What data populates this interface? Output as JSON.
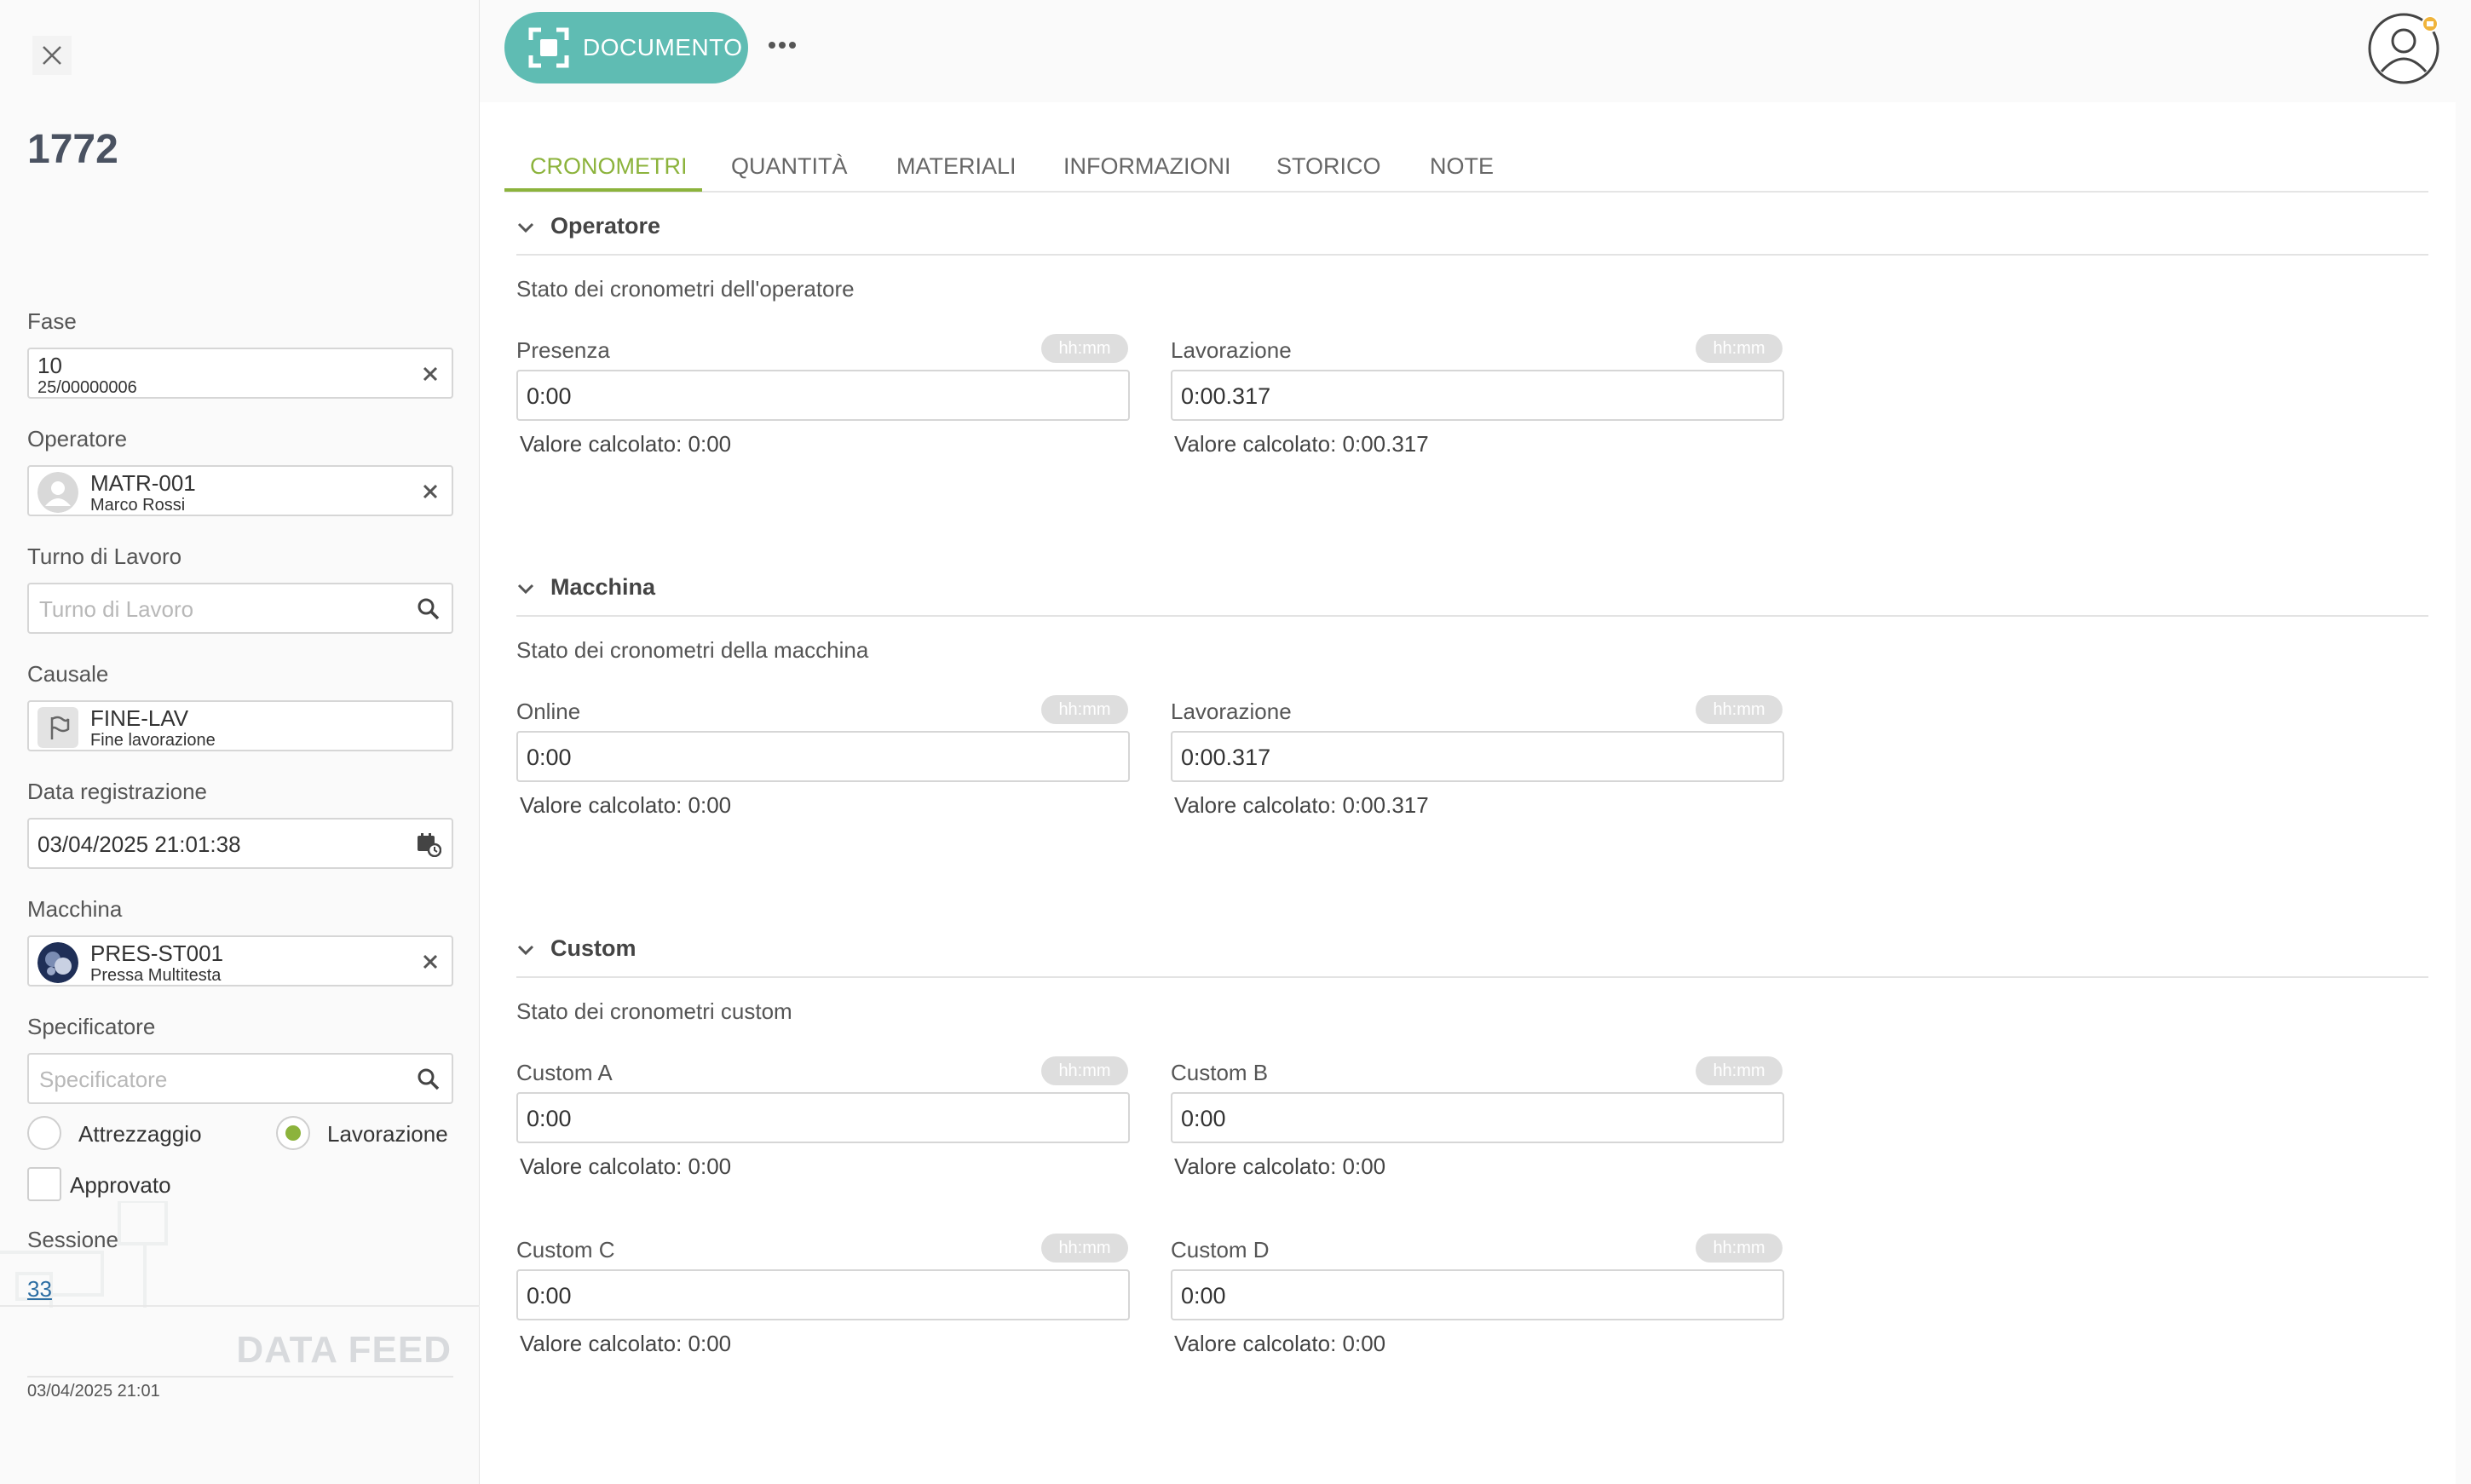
{
  "record": {
    "title": "1772"
  },
  "fields": {
    "fase": {
      "label": "Fase",
      "value": "10",
      "sub": "25/00000006"
    },
    "operatore": {
      "label": "Operatore",
      "value": "MATR-001",
      "sub": "Marco Rossi"
    },
    "turno": {
      "label": "Turno di Lavoro",
      "placeholder": "Turno di Lavoro"
    },
    "causale": {
      "label": "Causale",
      "value": "FINE-LAV",
      "sub": "Fine lavorazione"
    },
    "data_registrazione": {
      "label": "Data registrazione",
      "value": "03/04/2025 21:01:38"
    },
    "macchina": {
      "label": "Macchina",
      "value": "PRES-ST001",
      "sub": "Pressa Multitesta"
    },
    "specificatore": {
      "label": "Specificatore",
      "placeholder": "Specificatore"
    },
    "tipo": {
      "option1": "Attrezzaggio",
      "option2": "Lavorazione",
      "selected": "Lavorazione"
    },
    "approvato": {
      "label": "Approvato",
      "checked": false
    },
    "sessione": {
      "label": "Sessione",
      "value": "33"
    }
  },
  "datafeed": {
    "label": "DATA FEED",
    "date": "03/04/2025 21:01"
  },
  "toolbar": {
    "document_label": "DOCUMENTO"
  },
  "tabs": [
    {
      "label": "CRONOMETRI",
      "active": true
    },
    {
      "label": "QUANTITÀ"
    },
    {
      "label": "MATERIALI"
    },
    {
      "label": "INFORMAZIONI"
    },
    {
      "label": "STORICO"
    },
    {
      "label": "NOTE"
    }
  ],
  "sections": {
    "operatore": {
      "title": "Operatore",
      "desc": "Stato dei cronometri dell'operatore",
      "timers": [
        {
          "label": "Presenza",
          "badge": "hh:mm",
          "value": "0:00",
          "calc": "Valore calcolato: 0:00"
        },
        {
          "label": "Lavorazione",
          "badge": "hh:mm",
          "value": "0:00.317",
          "calc": "Valore calcolato: 0:00.317"
        }
      ]
    },
    "macchina": {
      "title": "Macchina",
      "desc": "Stato dei cronometri della macchina",
      "timers": [
        {
          "label": "Online",
          "badge": "hh:mm",
          "value": "0:00",
          "calc": "Valore calcolato: 0:00"
        },
        {
          "label": "Lavorazione",
          "badge": "hh:mm",
          "value": "0:00.317",
          "calc": "Valore calcolato: 0:00.317"
        }
      ]
    },
    "custom": {
      "title": "Custom",
      "desc": "Stato dei cronometri custom",
      "timers": [
        {
          "label": "Custom A",
          "badge": "hh:mm",
          "value": "0:00",
          "calc": "Valore calcolato: 0:00"
        },
        {
          "label": "Custom B",
          "badge": "hh:mm",
          "value": "0:00",
          "calc": "Valore calcolato: 0:00"
        },
        {
          "label": "Custom C",
          "badge": "hh:mm",
          "value": "0:00",
          "calc": "Valore calcolato: 0:00"
        },
        {
          "label": "Custom D",
          "badge": "hh:mm",
          "value": "0:00",
          "calc": "Valore calcolato: 0:00"
        }
      ]
    }
  },
  "colors": {
    "accent": "#8cb33c",
    "primary_button": "#5fbcb3",
    "link": "#2d6ea3"
  }
}
